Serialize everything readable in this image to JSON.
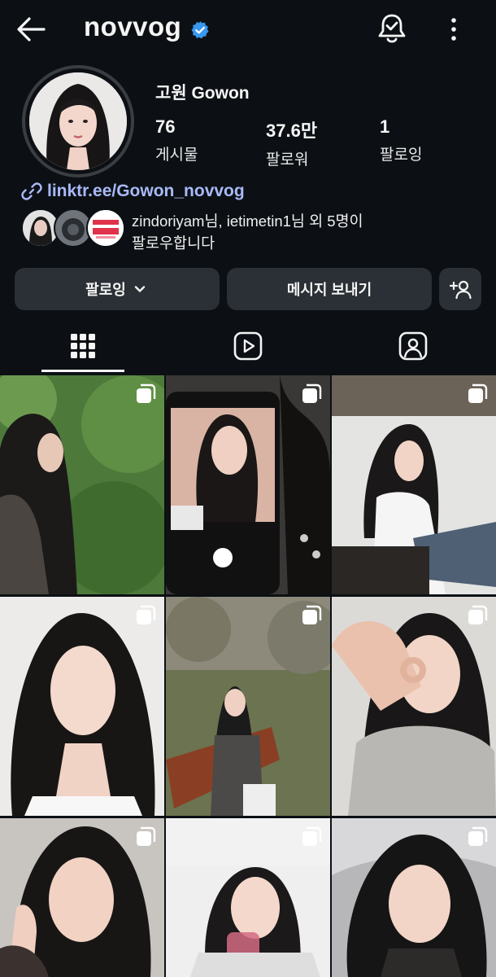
{
  "header": {
    "username": "novvog",
    "back_icon": "arrow-left-icon",
    "verified_icon": "verified-badge-icon",
    "notifications_icon": "bell-check-icon",
    "more_icon": "more-vertical-icon"
  },
  "profile": {
    "display_name": "고원 Gowon",
    "stats": [
      {
        "value": "76",
        "label": "게시물"
      },
      {
        "value": "37.6만",
        "label": "팔로워"
      },
      {
        "value": "1",
        "label": "팔로잉"
      }
    ],
    "link": "linktr.ee/Gowon_novvog",
    "mutual_followers_line1_names": "zindoriyam님, ietimetin1님",
    "mutual_followers_line1_rest": " 외 5명이",
    "mutual_followers_line2": "팔로우합니다"
  },
  "actions": {
    "following_label": "팔로잉",
    "message_label": "메시지 보내기",
    "add_user_icon": "add-person-icon"
  },
  "tabs": [
    {
      "icon": "grid-icon",
      "active": true
    },
    {
      "icon": "reels-icon",
      "active": false
    },
    {
      "icon": "tagged-icon",
      "active": false
    }
  ],
  "grid": {
    "posts": 9,
    "multi_icon": "carousel-icon"
  },
  "colors": {
    "background": "#0c1014",
    "button": "#2b3036",
    "link": "#a9b9f7",
    "verified": "#3897f0"
  }
}
